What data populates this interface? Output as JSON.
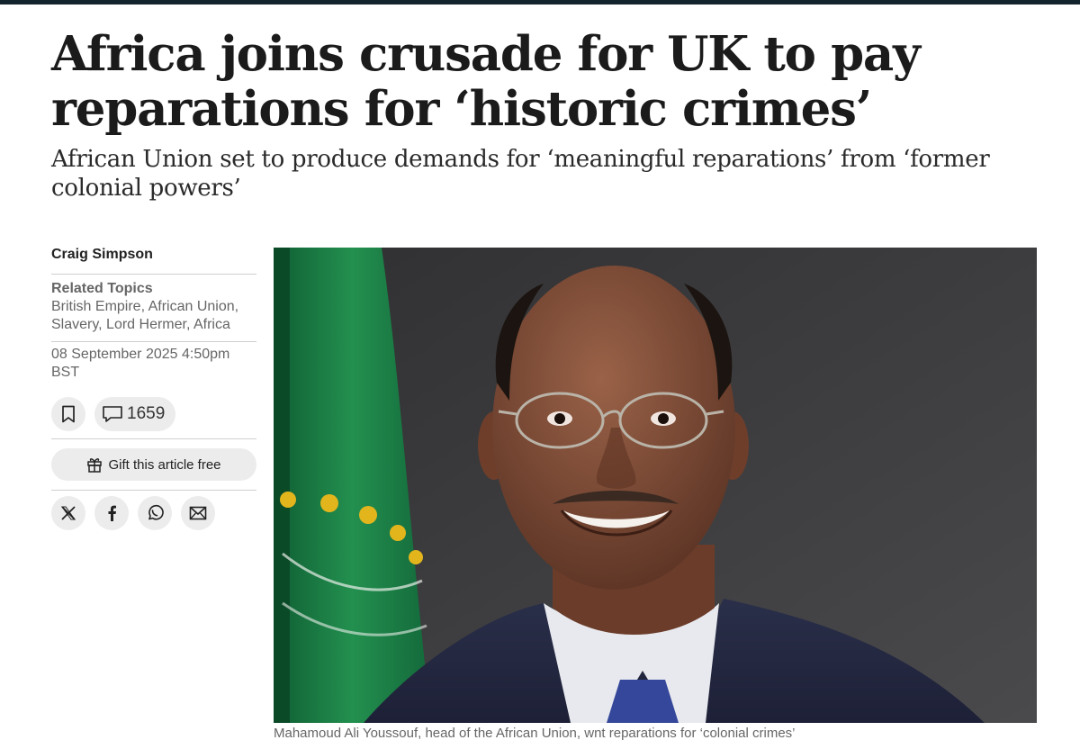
{
  "article": {
    "headline": "Africa joins crusade for UK to pay reparations for ‘historic crimes’",
    "standfirst": "African Union set to produce demands for ‘meaningful reparations’ from ‘former colonial powers’"
  },
  "sidebar": {
    "author": "Craig Simpson",
    "related_title": "Related Topics",
    "related_topics": "British Empire, African Union, Slavery, Lord Hermer, Africa",
    "date": "08 September 2025 4:50pm BST",
    "comment_count": "1659",
    "gift_label": "Gift this article free",
    "icons": {
      "bookmark": "bookmark-icon",
      "comment": "comment-icon",
      "gift": "gift-icon",
      "share": [
        "x-icon",
        "facebook-icon",
        "whatsapp-icon",
        "email-icon"
      ]
    }
  },
  "image": {
    "caption": "Mahamoud Ali Youssouf, head of the African Union, wnt reparations for ‘colonial crimes’"
  },
  "colors": {
    "topbar": "#13242f",
    "flag_green": "#1f8a4c",
    "flag_star": "#e3b51d",
    "button_bg": "#ececec"
  }
}
